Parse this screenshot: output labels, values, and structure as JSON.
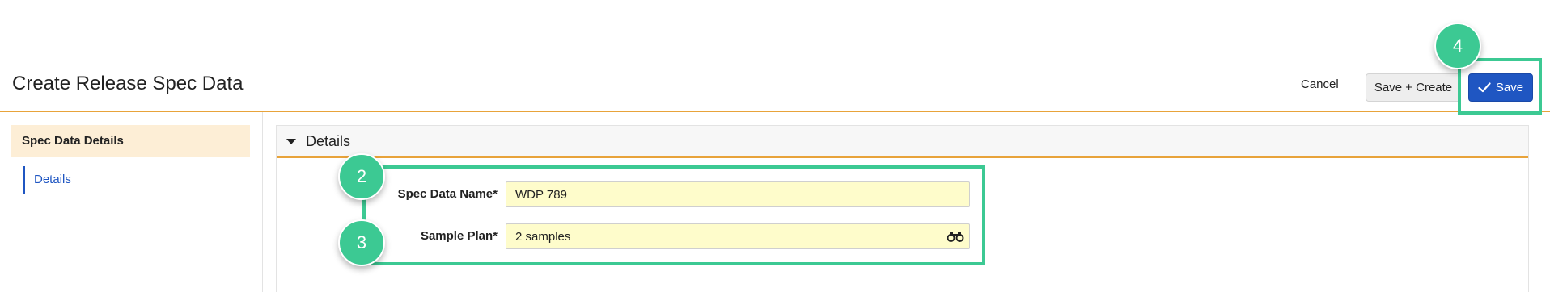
{
  "header": {
    "title": "Create Release Spec Data",
    "cancel_label": "Cancel",
    "save_create_label": "Save + Create",
    "save_label": "Save"
  },
  "sidebar": {
    "section_title": "Spec Data Details",
    "items": [
      {
        "label": "Details",
        "active": true
      }
    ]
  },
  "panel": {
    "title": "Details",
    "expanded": true
  },
  "form": {
    "spec_data_name": {
      "label": "Spec Data Name*",
      "value": "WDP 789"
    },
    "sample_plan": {
      "label": "Sample Plan*",
      "value": "2 samples",
      "icon": "binoculars-icon"
    }
  },
  "tutorial": {
    "badges": [
      "2",
      "3",
      "4"
    ]
  },
  "colors": {
    "accent_orange": "#e8a33a",
    "primary_blue": "#1f56c2",
    "highlight_green": "#3cc993",
    "sidebar_active_bg": "#fdeed6",
    "required_input_bg": "#fefccb"
  }
}
